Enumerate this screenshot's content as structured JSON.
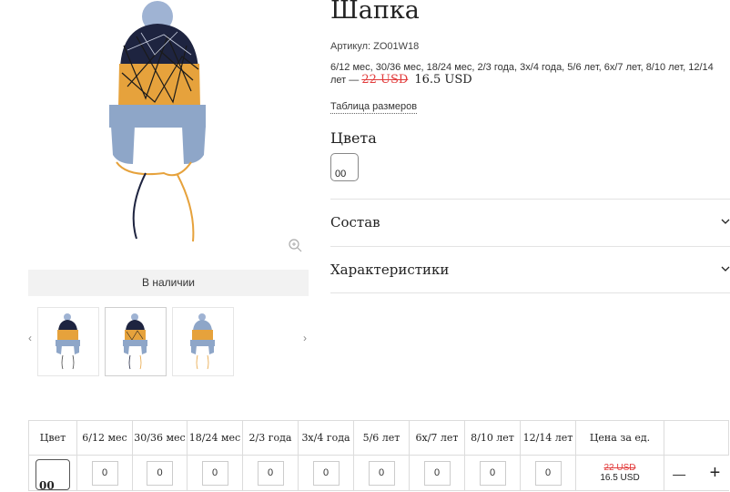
{
  "product": {
    "title": "Шапка",
    "article": "Артикул: ZO01W18",
    "sizes_text": "6/12 мес, 30/36 мес, 18/24 мес, 2/3 года, 3х/4 года, 5/6 лет, 6х/7 лет, 8/10 лет, 12/14 лет —",
    "old_price": "22 USD",
    "new_price": "16.5 USD",
    "size_table_link": "Таблица размеров",
    "availability": "В наличии"
  },
  "colors": {
    "title": "Цвета",
    "swatch_label": "00"
  },
  "accordion": [
    {
      "label": "Состав"
    },
    {
      "label": "Характеристики"
    }
  ],
  "thumbnails": {
    "prev_label": "‹",
    "next_label": "›"
  },
  "order_table": {
    "headers": [
      "Цвет",
      "6/12 мес",
      "30/36 мес",
      "18/24 мес",
      "2/3 года",
      "3х/4 года",
      "5/6 лет",
      "6х/7 лет",
      "8/10 лет",
      "12/14 лет",
      "Цена за ед."
    ],
    "row": {
      "color": "00",
      "quantities": [
        "0",
        "0",
        "0",
        "0",
        "0",
        "0",
        "0",
        "0",
        "0"
      ],
      "old_price": "22 USD",
      "new_price": "16.5 USD",
      "minus_label": "—",
      "plus_label": "+"
    }
  },
  "icons": {
    "zoom": "zoom-in-icon",
    "chevron": "chevron-down-icon"
  },
  "colors_palette": {
    "price_old": "#e23b3b",
    "hat_orange": "#e6a23c",
    "hat_navy": "#1e2440",
    "hat_blue": "#8ea6c8"
  }
}
